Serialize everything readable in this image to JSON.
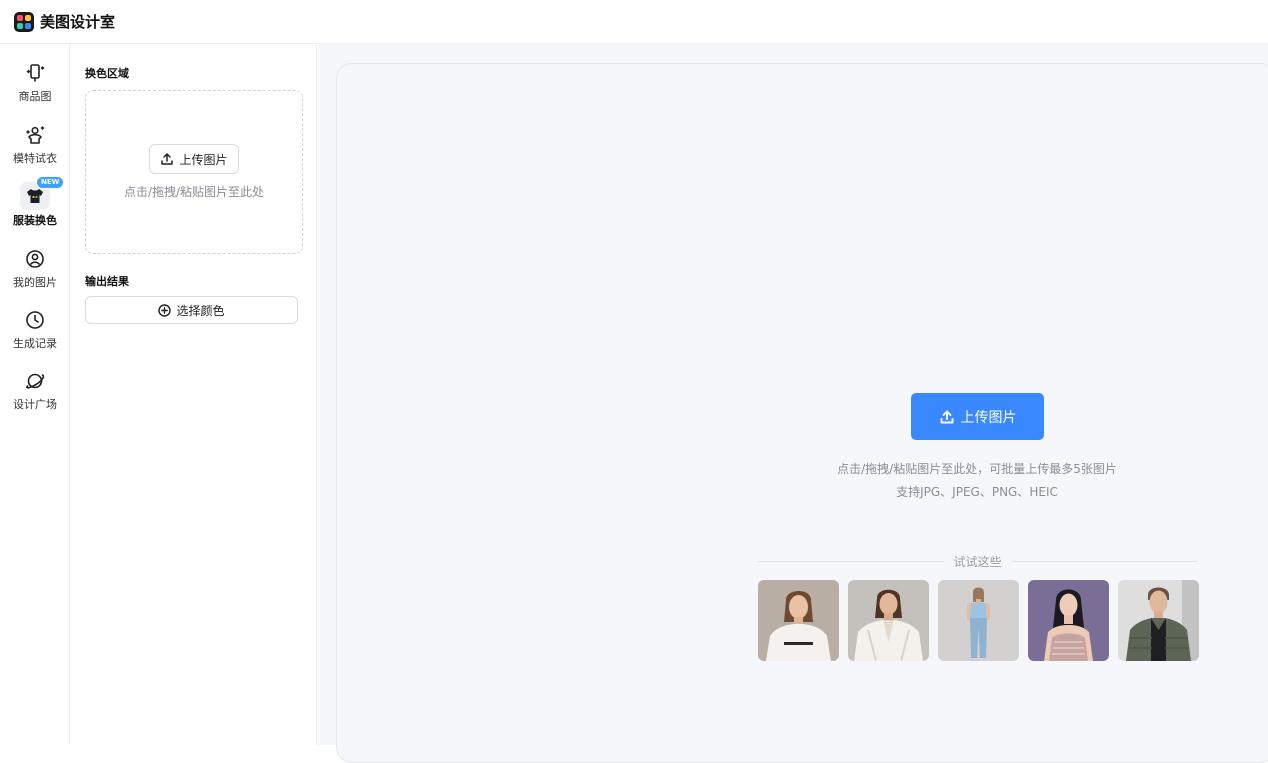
{
  "app": {
    "title": "美图设计室"
  },
  "rail": {
    "items": [
      {
        "label": "商品图",
        "icon": "product-phone-icon"
      },
      {
        "label": "模特试衣",
        "icon": "model-tryon-icon"
      },
      {
        "label": "服装换色",
        "icon": "tshirt-icon",
        "badge": "NEW",
        "active": true
      },
      {
        "label": "我的图片",
        "icon": "user-circle-icon"
      },
      {
        "label": "生成记录",
        "icon": "clock-icon"
      },
      {
        "label": "设计广场",
        "icon": "planet-icon"
      }
    ]
  },
  "panel": {
    "region_title": "换色区域",
    "upload_label": "上传图片",
    "drop_hint": "点击/拖拽/粘贴图片至此处",
    "output_title": "输出结果",
    "choose_color_label": "选择颜色"
  },
  "main": {
    "upload_label": "上传图片",
    "hint_line1": "点击/拖拽/粘贴图片至此处，可批量上传最多5张图片",
    "hint_line2": "支持JPG、JPEG、PNG、HEIC",
    "try_label": "试试这些",
    "examples": [
      {
        "icon": "model-white-tee-photo"
      },
      {
        "icon": "model-white-vest-photo"
      },
      {
        "icon": "model-blue-top-jeans-photo"
      },
      {
        "icon": "model-lace-dress-photo"
      },
      {
        "icon": "model-puffer-vest-photo"
      }
    ]
  },
  "colors": {
    "accent": "#3a88fd",
    "badge": "#3fa1ff",
    "logo": [
      "#ff4d6d",
      "#ffc233",
      "#35d0a5",
      "#3a88fd"
    ]
  }
}
